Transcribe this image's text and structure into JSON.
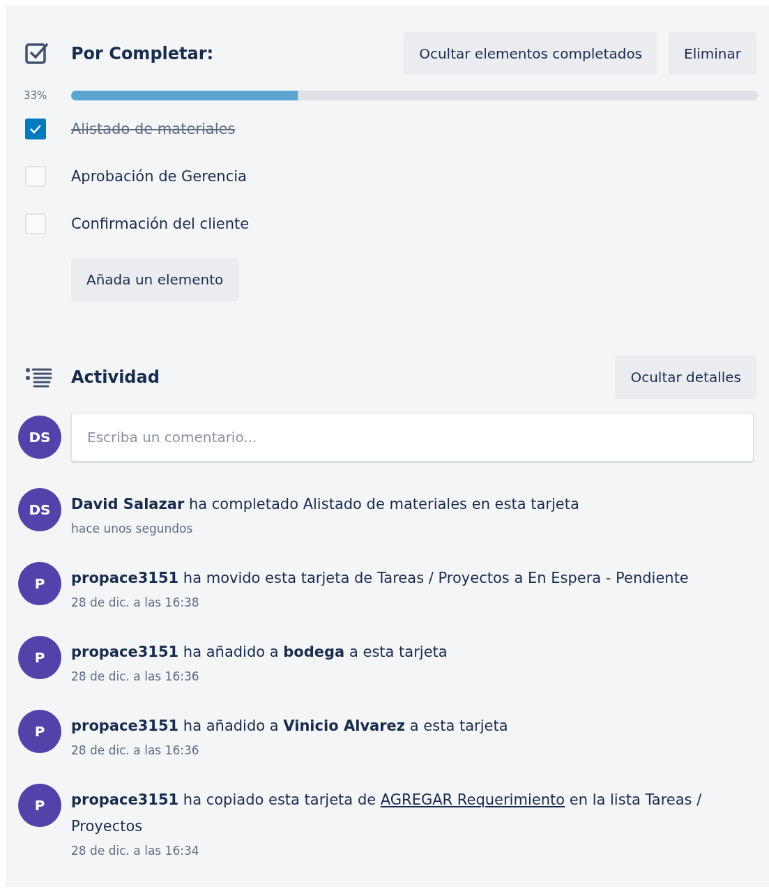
{
  "checklist": {
    "title": "Por Completar:",
    "buttons": [
      "Ocultar elementos completados",
      "Eliminar"
    ],
    "percent": "33%",
    "level": 0.33,
    "items": [
      {
        "label": "Alistado de materiales",
        "checked": true
      },
      {
        "label": "Aprobación de Gerencia",
        "checked": false
      },
      {
        "label": "Confirmación del cliente",
        "checked": false
      }
    ],
    "add_button": "Añada un elemento"
  },
  "activity": {
    "title": "Actividad",
    "toggle_button": "Ocultar detalles",
    "composer": {
      "avatar": "DS",
      "placeholder": "Escriba un comentario..."
    },
    "entries": [
      {
        "avatar": "DS",
        "text": "**David Salazar** ha completado Alistado de materiales en esta tarjeta",
        "time": "hace unos segundos"
      },
      {
        "avatar": "P",
        "text": "**propace3151** ha movido esta tarjeta de Tareas / Proyectos a En Espera - Pendiente",
        "time": "28 de dic. a las 16:38"
      },
      {
        "avatar": "P",
        "text": "**propace3151** ha añadido a **bodega** a esta tarjeta",
        "time": "28 de dic. a las 16:36"
      },
      {
        "avatar": "P",
        "text": "**propace3151** ha añadido a **Vinicio Alvarez** a esta tarjeta",
        "time": "28 de dic. a las 16:36"
      },
      {
        "avatar": "P",
        "text": "**propace3151** ha copiado esta tarjeta de",
        "link": "AGREGAR Requerimiento",
        "after": "en la lista Tareas / Proyectos",
        "time": "28 de dic. a las 16:34"
      }
    ]
  }
}
